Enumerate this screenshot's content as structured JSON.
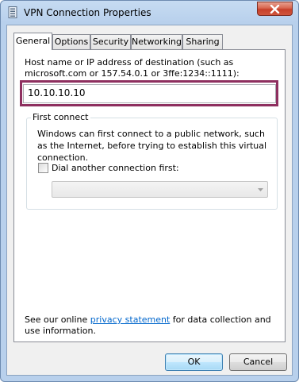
{
  "window": {
    "title": "VPN Connection Properties"
  },
  "tabs": [
    {
      "label": "General",
      "active": true
    },
    {
      "label": "Options",
      "active": false
    },
    {
      "label": "Security",
      "active": false
    },
    {
      "label": "Networking",
      "active": false
    },
    {
      "label": "Sharing",
      "active": false
    }
  ],
  "general": {
    "host_label": "Host name or IP address of destination (such as microsoft.com or 157.54.0.1 or 3ffe:1234::1111):",
    "host_value": "10.10.10.10",
    "first_connect": {
      "legend": "First connect",
      "description": "Windows can first connect to a public network, such as the Internet, before trying to establish this virtual connection.",
      "dial_checkbox_label": "Dial another connection first:",
      "dial_checked": false,
      "connection_select_value": ""
    },
    "privacy": {
      "prefix": "See our online ",
      "link": "privacy statement",
      "suffix": " for data collection and use information."
    }
  },
  "buttons": {
    "ok": "OK",
    "cancel": "Cancel"
  },
  "colors": {
    "highlight": "#8e2f5f",
    "link": "#0066cc",
    "close_button": "#c7402a"
  }
}
